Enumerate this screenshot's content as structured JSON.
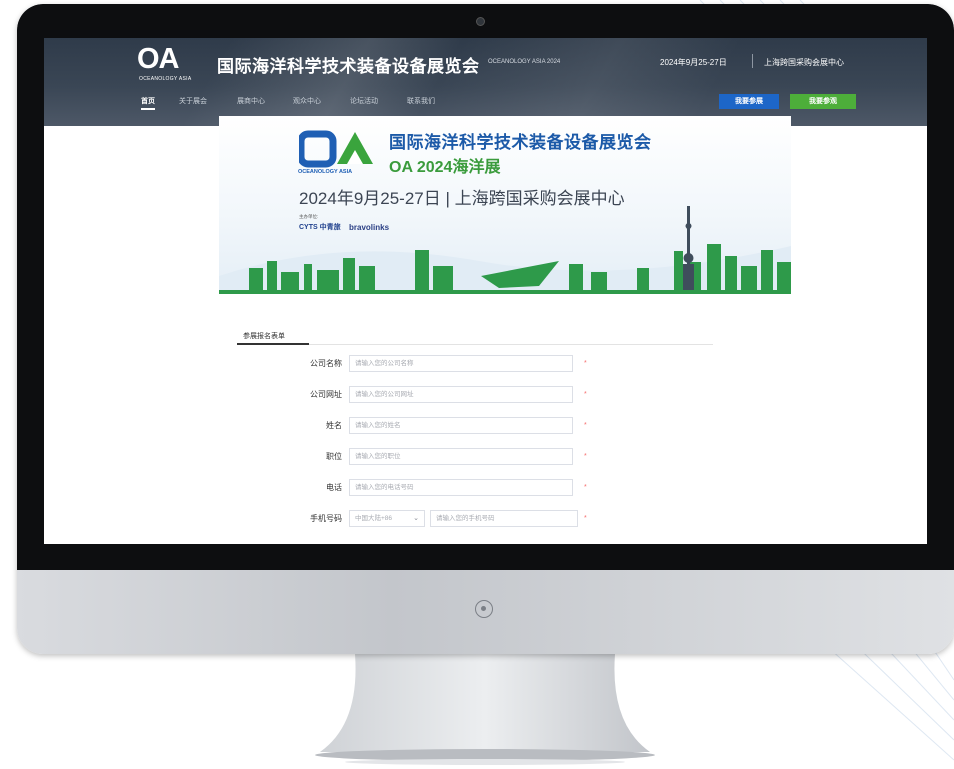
{
  "header": {
    "logo_main": "OA",
    "logo_small": "OCEANOLOGY ASIA",
    "title": "国际海洋科学技术装备设备展览会",
    "subtitle": "OCEANOLOGY ASIA 2024",
    "date": "2024年9月25-27日",
    "venue": "上海跨国采购会展中心"
  },
  "nav": {
    "items": [
      {
        "label": "首页",
        "active": true
      },
      {
        "label": "关于展会",
        "active": false
      },
      {
        "label": "展商中心",
        "active": false
      },
      {
        "label": "观众中心",
        "active": false
      },
      {
        "label": "论坛活动",
        "active": false
      },
      {
        "label": "联系我们",
        "active": false
      }
    ],
    "btn_exhibit": "我要参展",
    "btn_visit": "我要参观"
  },
  "banner": {
    "logo_main": "OA",
    "logo_text": "OCEANOLOGY ASIA",
    "title": "国际海洋科学技术装备设备展览会",
    "subtitle": "OA 2024海洋展",
    "date_venue": "2024年9月25-27日 | 上海跨国采购会展中心",
    "organizer_label": "主办单位:",
    "organizer_1": "CYTS 中青旅",
    "organizer_2": "bravolinks"
  },
  "form": {
    "tab_label": "参展报名表单",
    "required_mark": "*",
    "fields": [
      {
        "label": "公司名称",
        "placeholder": "请输入您的公司名称"
      },
      {
        "label": "公司网址",
        "placeholder": "请输入您的公司网址"
      },
      {
        "label": "姓名",
        "placeholder": "请输入您的姓名"
      },
      {
        "label": "职位",
        "placeholder": "请输入您的职位"
      },
      {
        "label": "电话",
        "placeholder": "请输入您的电话号码"
      }
    ],
    "mobile": {
      "label": "手机号码",
      "country_value": "中国大陆+86",
      "placeholder": "请输入您的手机号码"
    }
  },
  "colors": {
    "header_bg": "#34404f",
    "btn_exhibit": "#1d66c8",
    "btn_visit": "#4dae3a",
    "brand_blue": "#1c5aa8",
    "brand_green": "#3a9b3c",
    "required": "#f56c6c"
  }
}
